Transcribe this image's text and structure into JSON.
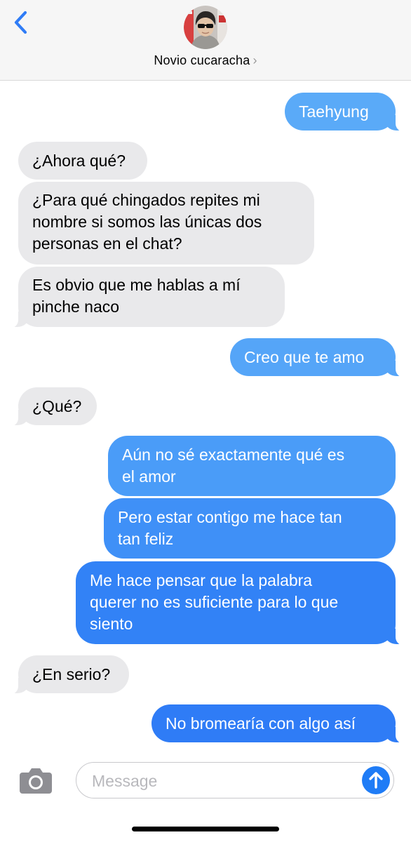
{
  "header": {
    "contact_name": "Novio cucaracha",
    "chevron": "›",
    "back_icon": "chevron-left-icon",
    "accent": "#2f7cf6"
  },
  "colors": {
    "incoming_bubble": "#e9e9eb",
    "outgoing_light": "#5aaaf8",
    "outgoing_mid": "#4a95f7",
    "outgoing_deep": "#2f7cf6"
  },
  "messages": [
    {
      "from": "me",
      "text": "Taehyung"
    },
    {
      "from": "them",
      "text": "¿Ahora qué?"
    },
    {
      "from": "them",
      "text": "¿Para qué chingados repites mi\nnombre si somos las únicas dos\npersonas en el chat?"
    },
    {
      "from": "them",
      "text": "Es obvio que me hablas a mí\npinche naco"
    },
    {
      "from": "me",
      "text": "Creo que te amo"
    },
    {
      "from": "them",
      "text": "¿Qué?"
    },
    {
      "from": "me",
      "text": "Aún no sé exactamente qué es\nel amor"
    },
    {
      "from": "me",
      "text": "Pero estar contigo me hace tan\ntan feliz"
    },
    {
      "from": "me",
      "text": "Me hace pensar que la palabra\nquerer no es suficiente para lo que\nsiento"
    },
    {
      "from": "them",
      "text": "¿En serio?"
    },
    {
      "from": "me",
      "text": "No bromearía con algo así"
    }
  ],
  "composer": {
    "placeholder": "Message",
    "camera_icon": "camera-icon",
    "send_icon": "arrow-up-icon"
  }
}
